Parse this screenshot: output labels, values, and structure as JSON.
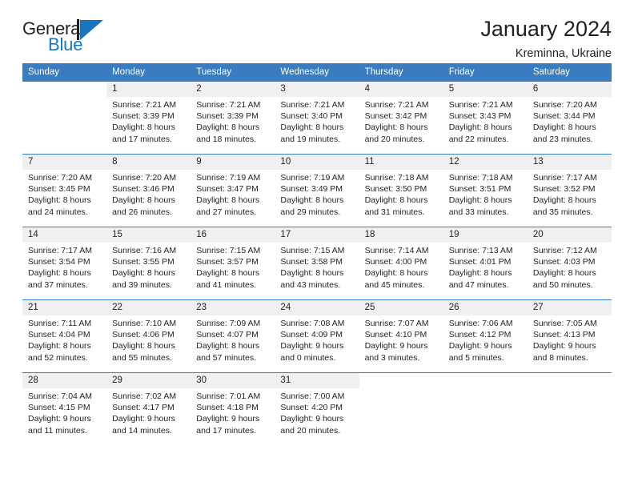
{
  "brand": {
    "name_part1": "General",
    "name_part2": "Blue",
    "mark": "triangle-logo"
  },
  "header": {
    "title": "January 2024",
    "subtitle": "Kreminna, Ukraine"
  },
  "colors": {
    "header_blue": "#3a7cc0",
    "brand_blue": "#1b75bc",
    "shaded_row": "#f0f0f0",
    "text": "#231f20"
  },
  "calendar": {
    "weekday_headers": [
      "Sunday",
      "Monday",
      "Tuesday",
      "Wednesday",
      "Thursday",
      "Friday",
      "Saturday"
    ],
    "weeks": [
      [
        {
          "day": "",
          "sunrise": "",
          "sunset": "",
          "daylight1": "",
          "daylight2": ""
        },
        {
          "day": "1",
          "sunrise": "Sunrise: 7:21 AM",
          "sunset": "Sunset: 3:39 PM",
          "daylight1": "Daylight: 8 hours",
          "daylight2": "and 17 minutes."
        },
        {
          "day": "2",
          "sunrise": "Sunrise: 7:21 AM",
          "sunset": "Sunset: 3:39 PM",
          "daylight1": "Daylight: 8 hours",
          "daylight2": "and 18 minutes."
        },
        {
          "day": "3",
          "sunrise": "Sunrise: 7:21 AM",
          "sunset": "Sunset: 3:40 PM",
          "daylight1": "Daylight: 8 hours",
          "daylight2": "and 19 minutes."
        },
        {
          "day": "4",
          "sunrise": "Sunrise: 7:21 AM",
          "sunset": "Sunset: 3:42 PM",
          "daylight1": "Daylight: 8 hours",
          "daylight2": "and 20 minutes."
        },
        {
          "day": "5",
          "sunrise": "Sunrise: 7:21 AM",
          "sunset": "Sunset: 3:43 PM",
          "daylight1": "Daylight: 8 hours",
          "daylight2": "and 22 minutes."
        },
        {
          "day": "6",
          "sunrise": "Sunrise: 7:20 AM",
          "sunset": "Sunset: 3:44 PM",
          "daylight1": "Daylight: 8 hours",
          "daylight2": "and 23 minutes."
        }
      ],
      [
        {
          "day": "7",
          "sunrise": "Sunrise: 7:20 AM",
          "sunset": "Sunset: 3:45 PM",
          "daylight1": "Daylight: 8 hours",
          "daylight2": "and 24 minutes."
        },
        {
          "day": "8",
          "sunrise": "Sunrise: 7:20 AM",
          "sunset": "Sunset: 3:46 PM",
          "daylight1": "Daylight: 8 hours",
          "daylight2": "and 26 minutes."
        },
        {
          "day": "9",
          "sunrise": "Sunrise: 7:19 AM",
          "sunset": "Sunset: 3:47 PM",
          "daylight1": "Daylight: 8 hours",
          "daylight2": "and 27 minutes."
        },
        {
          "day": "10",
          "sunrise": "Sunrise: 7:19 AM",
          "sunset": "Sunset: 3:49 PM",
          "daylight1": "Daylight: 8 hours",
          "daylight2": "and 29 minutes."
        },
        {
          "day": "11",
          "sunrise": "Sunrise: 7:18 AM",
          "sunset": "Sunset: 3:50 PM",
          "daylight1": "Daylight: 8 hours",
          "daylight2": "and 31 minutes."
        },
        {
          "day": "12",
          "sunrise": "Sunrise: 7:18 AM",
          "sunset": "Sunset: 3:51 PM",
          "daylight1": "Daylight: 8 hours",
          "daylight2": "and 33 minutes."
        },
        {
          "day": "13",
          "sunrise": "Sunrise: 7:17 AM",
          "sunset": "Sunset: 3:52 PM",
          "daylight1": "Daylight: 8 hours",
          "daylight2": "and 35 minutes."
        }
      ],
      [
        {
          "day": "14",
          "sunrise": "Sunrise: 7:17 AM",
          "sunset": "Sunset: 3:54 PM",
          "daylight1": "Daylight: 8 hours",
          "daylight2": "and 37 minutes."
        },
        {
          "day": "15",
          "sunrise": "Sunrise: 7:16 AM",
          "sunset": "Sunset: 3:55 PM",
          "daylight1": "Daylight: 8 hours",
          "daylight2": "and 39 minutes."
        },
        {
          "day": "16",
          "sunrise": "Sunrise: 7:15 AM",
          "sunset": "Sunset: 3:57 PM",
          "daylight1": "Daylight: 8 hours",
          "daylight2": "and 41 minutes."
        },
        {
          "day": "17",
          "sunrise": "Sunrise: 7:15 AM",
          "sunset": "Sunset: 3:58 PM",
          "daylight1": "Daylight: 8 hours",
          "daylight2": "and 43 minutes."
        },
        {
          "day": "18",
          "sunrise": "Sunrise: 7:14 AM",
          "sunset": "Sunset: 4:00 PM",
          "daylight1": "Daylight: 8 hours",
          "daylight2": "and 45 minutes."
        },
        {
          "day": "19",
          "sunrise": "Sunrise: 7:13 AM",
          "sunset": "Sunset: 4:01 PM",
          "daylight1": "Daylight: 8 hours",
          "daylight2": "and 47 minutes."
        },
        {
          "day": "20",
          "sunrise": "Sunrise: 7:12 AM",
          "sunset": "Sunset: 4:03 PM",
          "daylight1": "Daylight: 8 hours",
          "daylight2": "and 50 minutes."
        }
      ],
      [
        {
          "day": "21",
          "sunrise": "Sunrise: 7:11 AM",
          "sunset": "Sunset: 4:04 PM",
          "daylight1": "Daylight: 8 hours",
          "daylight2": "and 52 minutes."
        },
        {
          "day": "22",
          "sunrise": "Sunrise: 7:10 AM",
          "sunset": "Sunset: 4:06 PM",
          "daylight1": "Daylight: 8 hours",
          "daylight2": "and 55 minutes."
        },
        {
          "day": "23",
          "sunrise": "Sunrise: 7:09 AM",
          "sunset": "Sunset: 4:07 PM",
          "daylight1": "Daylight: 8 hours",
          "daylight2": "and 57 minutes."
        },
        {
          "day": "24",
          "sunrise": "Sunrise: 7:08 AM",
          "sunset": "Sunset: 4:09 PM",
          "daylight1": "Daylight: 9 hours",
          "daylight2": "and 0 minutes."
        },
        {
          "day": "25",
          "sunrise": "Sunrise: 7:07 AM",
          "sunset": "Sunset: 4:10 PM",
          "daylight1": "Daylight: 9 hours",
          "daylight2": "and 3 minutes."
        },
        {
          "day": "26",
          "sunrise": "Sunrise: 7:06 AM",
          "sunset": "Sunset: 4:12 PM",
          "daylight1": "Daylight: 9 hours",
          "daylight2": "and 5 minutes."
        },
        {
          "day": "27",
          "sunrise": "Sunrise: 7:05 AM",
          "sunset": "Sunset: 4:13 PM",
          "daylight1": "Daylight: 9 hours",
          "daylight2": "and 8 minutes."
        }
      ],
      [
        {
          "day": "28",
          "sunrise": "Sunrise: 7:04 AM",
          "sunset": "Sunset: 4:15 PM",
          "daylight1": "Daylight: 9 hours",
          "daylight2": "and 11 minutes."
        },
        {
          "day": "29",
          "sunrise": "Sunrise: 7:02 AM",
          "sunset": "Sunset: 4:17 PM",
          "daylight1": "Daylight: 9 hours",
          "daylight2": "and 14 minutes."
        },
        {
          "day": "30",
          "sunrise": "Sunrise: 7:01 AM",
          "sunset": "Sunset: 4:18 PM",
          "daylight1": "Daylight: 9 hours",
          "daylight2": "and 17 minutes."
        },
        {
          "day": "31",
          "sunrise": "Sunrise: 7:00 AM",
          "sunset": "Sunset: 4:20 PM",
          "daylight1": "Daylight: 9 hours",
          "daylight2": "and 20 minutes."
        },
        {
          "day": "",
          "sunrise": "",
          "sunset": "",
          "daylight1": "",
          "daylight2": ""
        },
        {
          "day": "",
          "sunrise": "",
          "sunset": "",
          "daylight1": "",
          "daylight2": ""
        },
        {
          "day": "",
          "sunrise": "",
          "sunset": "",
          "daylight1": "",
          "daylight2": ""
        }
      ]
    ]
  }
}
